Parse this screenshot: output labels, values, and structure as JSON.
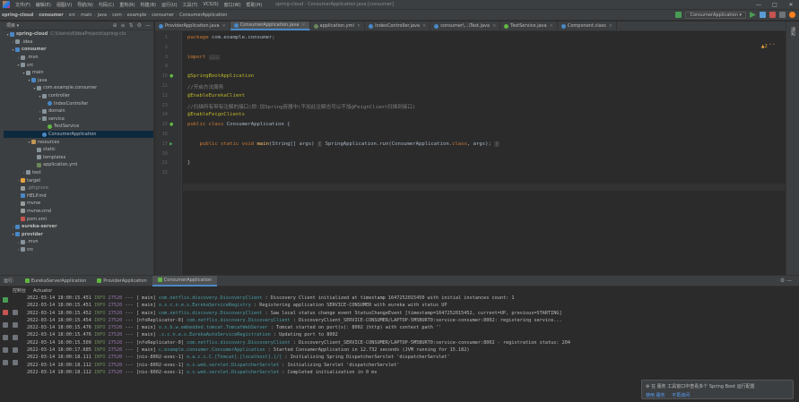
{
  "menubar": {
    "items": [
      "文件(F)",
      "编辑(E)",
      "视图(V)",
      "导航(N)",
      "代码(C)",
      "重构(R)",
      "构建(B)",
      "运行(U)",
      "工具(T)",
      "VCS(S)",
      "窗口(W)",
      "帮助(H)"
    ],
    "window_title": "spring-cloud - ConsumerApplication.java [consumer]",
    "controls": [
      "—",
      "□",
      "✕"
    ]
  },
  "navbar": {
    "crumbs": [
      "spring-cloud",
      "consumer",
      "src",
      "main",
      "java",
      "com",
      "example",
      "consumer",
      "ConsumerApplication"
    ],
    "run_config": "ConsumerApplication ▾"
  },
  "project": {
    "title": "项目 ▾",
    "header_icons": [
      "⊕",
      "≡",
      "⇅",
      "⚙",
      "—"
    ],
    "tree": [
      {
        "indent": 0,
        "arrow": "▾",
        "icon": "module",
        "label": "spring-cloud",
        "hint": "C:\\Users\\d\\IdeaProjects\\spring-clo",
        "bold": true
      },
      {
        "indent": 1,
        "arrow": "›",
        "icon": "folder",
        "label": ".idea"
      },
      {
        "indent": 1,
        "arrow": "▾",
        "icon": "module",
        "label": "consumer",
        "bold": true
      },
      {
        "indent": 2,
        "arrow": "›",
        "icon": "folder",
        "label": ".mvn"
      },
      {
        "indent": 2,
        "arrow": "▾",
        "icon": "folder",
        "label": "src"
      },
      {
        "indent": 3,
        "arrow": "▾",
        "icon": "folder",
        "label": "main"
      },
      {
        "indent": 4,
        "arrow": "▾",
        "icon": "src-folder",
        "label": "java"
      },
      {
        "indent": 5,
        "arrow": "▾",
        "icon": "package",
        "label": "com.example.consumer"
      },
      {
        "indent": 6,
        "arrow": "▾",
        "icon": "package",
        "label": "controller"
      },
      {
        "indent": 7,
        "arrow": "",
        "icon": "class",
        "label": "IndexController"
      },
      {
        "indent": 6,
        "arrow": "›",
        "icon": "package",
        "label": "domain"
      },
      {
        "indent": 6,
        "arrow": "▾",
        "icon": "package",
        "label": "service"
      },
      {
        "indent": 7,
        "arrow": "",
        "icon": "interface",
        "label": "TestService"
      },
      {
        "indent": 6,
        "arrow": "",
        "icon": "class",
        "label": "ConsumerApplication",
        "selected": true
      },
      {
        "indent": 4,
        "arrow": "▾",
        "icon": "res-folder",
        "label": "resources"
      },
      {
        "indent": 5,
        "arrow": "",
        "icon": "folder",
        "label": "static"
      },
      {
        "indent": 5,
        "arrow": "",
        "icon": "folder",
        "label": "templates"
      },
      {
        "indent": 5,
        "arrow": "",
        "icon": "yml",
        "label": "application.yml"
      },
      {
        "indent": 3,
        "arrow": "›",
        "icon": "folder",
        "label": "test"
      },
      {
        "indent": 2,
        "arrow": "›",
        "icon": "target",
        "label": "target"
      },
      {
        "indent": 2,
        "arrow": "",
        "icon": "file",
        "label": ".gitignore",
        "dim": true
      },
      {
        "indent": 2,
        "arrow": "",
        "icon": "md",
        "label": "HELP.md"
      },
      {
        "indent": 2,
        "arrow": "",
        "icon": "file",
        "label": "mvnw"
      },
      {
        "indent": 2,
        "arrow": "",
        "icon": "file",
        "label": "mvnw.cmd"
      },
      {
        "indent": 2,
        "arrow": "",
        "icon": "maven",
        "label": "pom.xml"
      },
      {
        "indent": 1,
        "arrow": "›",
        "icon": "module",
        "label": "eureka-server",
        "bold": true
      },
      {
        "indent": 1,
        "arrow": "▾",
        "icon": "module",
        "label": "provider",
        "bold": true
      },
      {
        "indent": 2,
        "arrow": "›",
        "icon": "folder",
        "label": ".mvn"
      },
      {
        "indent": 2,
        "arrow": "›",
        "icon": "folder",
        "label": "src"
      }
    ]
  },
  "editor": {
    "tabs": [
      {
        "label": "ProviderApplication.java",
        "color": "#4a88c7"
      },
      {
        "label": "ConsumerApplication.java",
        "color": "#4a88c7",
        "active": true
      },
      {
        "label": "application.yml",
        "color": "#6a8759"
      },
      {
        "label": "IndexController.java",
        "color": "#4a88c7"
      },
      {
        "label": "consumer\\...\\Test.java",
        "color": "#4a88c7"
      },
      {
        "label": "TestService.java",
        "color": "#62b543"
      },
      {
        "label": "Component.class",
        "color": "#4a88c7"
      }
    ],
    "warning": "▲2  ˄  ˅",
    "lines": [
      {
        "n": "1",
        "html": "<span class='kw'>package</span> com.example.consumer;"
      },
      {
        "n": "2",
        "html": ""
      },
      {
        "n": "3",
        "html": "<span class='kw'>import</span> <span class='fold'>...</span>"
      },
      {
        "n": "9",
        "html": ""
      },
      {
        "n": "10",
        "html": "<span class='ann'>@SpringBootApplication</span>"
      },
      {
        "n": "11",
        "html": "<span class='cmt'>//开启方法服务</span>"
      },
      {
        "n": "12",
        "html": "<span class='ann'>@EnableEurekaClient</span>"
      },
      {
        "n": "13",
        "html": "<span class='cmt'>//扫描所有带有注解的接口(即:加Spring容器中(不加此注解也可以不加@FeignClient扫描到接口)</span>"
      },
      {
        "n": "14",
        "html": "<span class='ann'>@EnableFeignClients</span>"
      },
      {
        "n": "15",
        "html": "<span class='kw'>public class</span> ConsumerApplication {"
      },
      {
        "n": "16",
        "html": ""
      },
      {
        "n": "17",
        "html": "    <span class='kw'>public static void</span> <span class='fn'>main</span>(String[] args) <span class='fold'>{</span> SpringApplication.<i>run</i>(ConsumerApplication.<span class='kw'>class</span>, args); <span class='fold'>}</span>"
      },
      {
        "n": "20",
        "html": ""
      },
      {
        "n": "21",
        "html": "}"
      },
      {
        "n": "22",
        "html": ""
      }
    ]
  },
  "runpanel": {
    "label": "运行:",
    "tabs": [
      {
        "label": "EurekaServerApplication"
      },
      {
        "label": "ProviderApplication"
      },
      {
        "label": "ConsumerApplication",
        "active": true
      }
    ],
    "subtabs": [
      "控制台",
      "Actuator"
    ],
    "log": [
      {
        "ts": "2022-03-14 18:00:15.451",
        "lv": "INFO",
        "pid": "27520",
        "th": "---  [           main]",
        "lg": "com.netflix.discovery.DiscoveryClient    ",
        "msg": ": Discovery Client initialized at timestamp 1647252015450 with initial instances count: 1"
      },
      {
        "ts": "2022-03-14 18:00:15.451",
        "lv": "INFO",
        "pid": "27520",
        "th": "---  [           main]",
        "lg": "o.s.c.n.e.s.EurekaServiceRegistry        ",
        "msg": ": Registering application SERVICE-CONSUMER with eureka with status UP"
      },
      {
        "ts": "2022-03-14 18:00:15.452",
        "lv": "INFO",
        "pid": "27520",
        "th": "---  [           main]",
        "lg": "com.netflix.discovery.DiscoveryClient    ",
        "msg": ": Saw local status change event StatusChangeEvent [timestamp=1647252015452, current=UP, previous=STARTING]"
      },
      {
        "ts": "2022-03-14 18:00:15.454",
        "lv": "INFO",
        "pid": "27520",
        "th": "--- [nfoReplicator-0]",
        "lg": "com.netflix.discovery.DiscoveryClient    ",
        "msg": ": DiscoveryClient_SERVICE-CONSUMER/LAPTOP-5M5BURT0:service-consumer:8002: registering service..."
      },
      {
        "ts": "2022-03-14 18:00:15.476",
        "lv": "INFO",
        "pid": "27520",
        "th": "---  [           main]",
        "lg": "o.s.b.w.embedded.tomcat.TomcatWebServer  ",
        "msg": ": Tomcat started on port(s): 8002 (http) with context path ''"
      },
      {
        "ts": "2022-03-14 18:00:15.476",
        "lv": "INFO",
        "pid": "27520",
        "th": "---  [           main]",
        "lg": ".s.c.n.e.s.EurekaAutoServiceRegistration",
        "msg": ": Updating port to 8002"
      },
      {
        "ts": "2022-03-14 18:00:15.509",
        "lv": "INFO",
        "pid": "27520",
        "th": "--- [nfoReplicator-0]",
        "lg": "com.netflix.discovery.DiscoveryClient    ",
        "msg": ": DiscoveryClient_SERVICE-CONSUMER/LAPTOP-5M5BURT0:service-consumer:8002 - registration status: 204"
      },
      {
        "ts": "2022-03-14 18:00:17.685",
        "lv": "INFO",
        "pid": "27520",
        "th": "---  [           main]",
        "lg": "c.example.consumer.ConsumerApplication   ",
        "msg": ": Started ConsumerApplication in 12.732 seconds (JVM running for 15.182)"
      },
      {
        "ts": "2022-03-14 18:00:18.111",
        "lv": "INFO",
        "pid": "27520",
        "th": "--- [nio-8002-exec-1]",
        "lg": "o.a.c.c.C.[Tomcat].[localhost].[/]      ",
        "msg": ": Initializing Spring DispatcherServlet 'dispatcherServlet'"
      },
      {
        "ts": "2022-03-14 18:00:18.112",
        "lv": "INFO",
        "pid": "27520",
        "th": "--- [nio-8002-exec-1]",
        "lg": "o.s.web.servlet.DispatcherServlet        ",
        "msg": ": Initializing Servlet 'dispatcherServlet'"
      },
      {
        "ts": "2022-03-14 18:00:18.112",
        "lv": "INFO",
        "pid": "27520",
        "th": "--- [nio-8002-exec-1]",
        "lg": "o.s.web.servlet.DispatcherServlet        ",
        "msg": ": Completed initialization in 0 ms"
      }
    ]
  },
  "notification": {
    "text": "⚙ 在 服务 工具窗口中查看多个 Spring Boot 运行配置",
    "links": [
      "使用 服务",
      "不再询问"
    ]
  },
  "right_strip": {
    "label": "通知"
  },
  "colors": {
    "accent": "#4a88c7",
    "selection": "#0d293e",
    "keyword": "#cc7832",
    "annotation": "#bbb529",
    "comment": "#808080",
    "method": "#ffc66d"
  }
}
